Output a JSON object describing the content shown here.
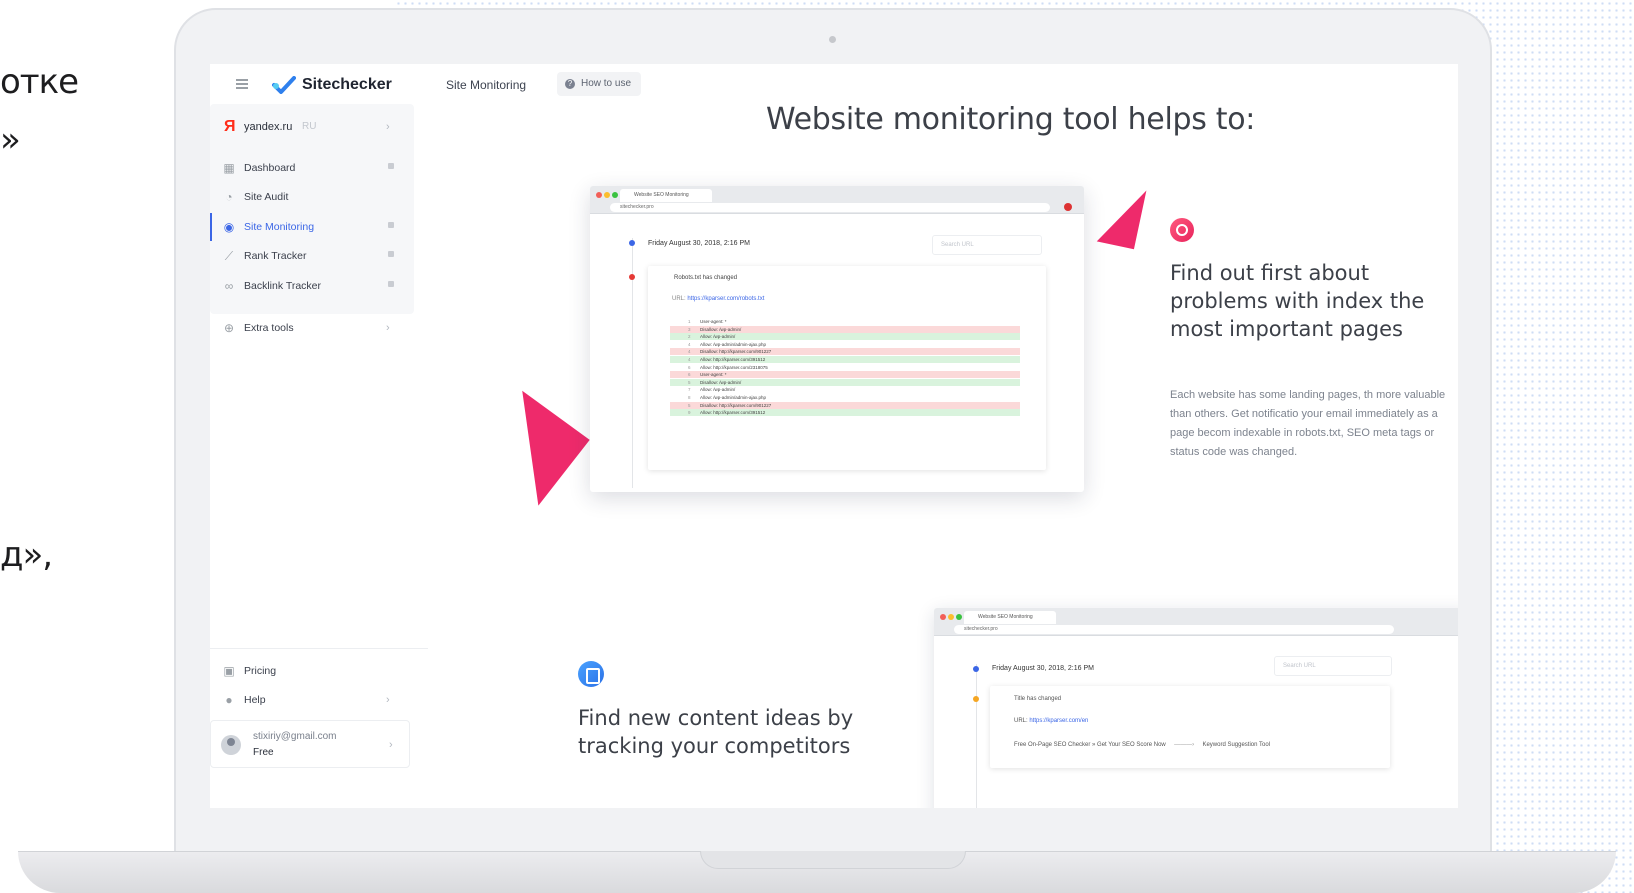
{
  "side_text": [
    "отке",
    "»",
    "д»,"
  ],
  "app": {
    "logo": "Sitechecker",
    "breadcrumb": "Site Monitoring",
    "how_to": "How to use"
  },
  "site": {
    "icon": "Я",
    "name": "yandex.ru",
    "lang": "RU"
  },
  "nav": [
    {
      "label": "Dashboard"
    },
    {
      "label": "Site Audit"
    },
    {
      "label": "Site Monitoring"
    },
    {
      "label": "Rank Tracker"
    },
    {
      "label": "Backlink Tracker"
    }
  ],
  "extra_tools": "Extra tools",
  "bottom_nav": [
    {
      "label": "Pricing"
    },
    {
      "label": "Help"
    }
  ],
  "user": {
    "email": "stixiriy@gmail.com",
    "plan": "Free"
  },
  "main": {
    "headline": "Website monitoring tool helps to:",
    "feature1": {
      "title": "Find out first about problems with index the most important pages",
      "body": "Each website has some landing pages, th more valuable than others. Get notificatio your email immediately as a page becom indexable in robots.txt, SEO meta tags or status code was changed."
    },
    "feature2": {
      "title": "Find new content ideas by tracking your competitors"
    }
  },
  "mock1": {
    "tab": "Website SEO Monitoring",
    "url": "sitechecker.pro",
    "date": "Friday August 30, 2018, 2:16 PM",
    "search": "Search URL",
    "card_title": "Robots.txt has changed",
    "card_url_label": "URL:",
    "card_url": "https://kparser.com/robots.txt",
    "code_lines": [
      {
        "n": "1",
        "t": "User-agent: *",
        "s": ""
      },
      {
        "n": "3",
        "t": "Disallow: /wp-admin/",
        "s": "r"
      },
      {
        "n": "2",
        "t": "Allow: /wp-admin/",
        "s": "g"
      },
      {
        "n": "4",
        "t": "Allow: /wp-admin/admin-ajax.php",
        "s": ""
      },
      {
        "n": "4",
        "t": "Disallow: http://kparser.com/901227",
        "s": "r"
      },
      {
        "n": "4",
        "t": "Allow: http://kparser.com/391512",
        "s": "g"
      },
      {
        "n": "6",
        "t": "Allow: http://kparser.com/2318075",
        "s": ""
      },
      {
        "n": "6",
        "t": "User-agent: *",
        "s": "r"
      },
      {
        "n": "5",
        "t": "Disallow: /wp-admin/",
        "s": "g"
      },
      {
        "n": "7",
        "t": "Allow: /wp-admin/",
        "s": ""
      },
      {
        "n": "8",
        "t": "Allow: /wp-admin/admin-ajax.php",
        "s": ""
      },
      {
        "n": "5",
        "t": "Disallow: http://kparser.com/901227",
        "s": "r"
      },
      {
        "n": "9",
        "t": "Allow: http://kparser.com/391512",
        "s": "g"
      }
    ]
  },
  "mock2": {
    "tab": "Website SEO Monitoring",
    "url": "sitechecker.pro",
    "date": "Friday August 30, 2018, 2:16 PM",
    "search": "Search URL",
    "card_title": "Title has changed",
    "card_url_label": "URL:",
    "card_url": "https://kparser.com/en",
    "old_title": "Free On-Page SEO Checker » Get Your SEO Score Now",
    "arrow": "———›",
    "new_title": "Keyword Suggestion Tool"
  },
  "colors": {
    "accent": "#3b66e6",
    "brand_pink": "#ee2a6b",
    "text": "#3c4048"
  }
}
